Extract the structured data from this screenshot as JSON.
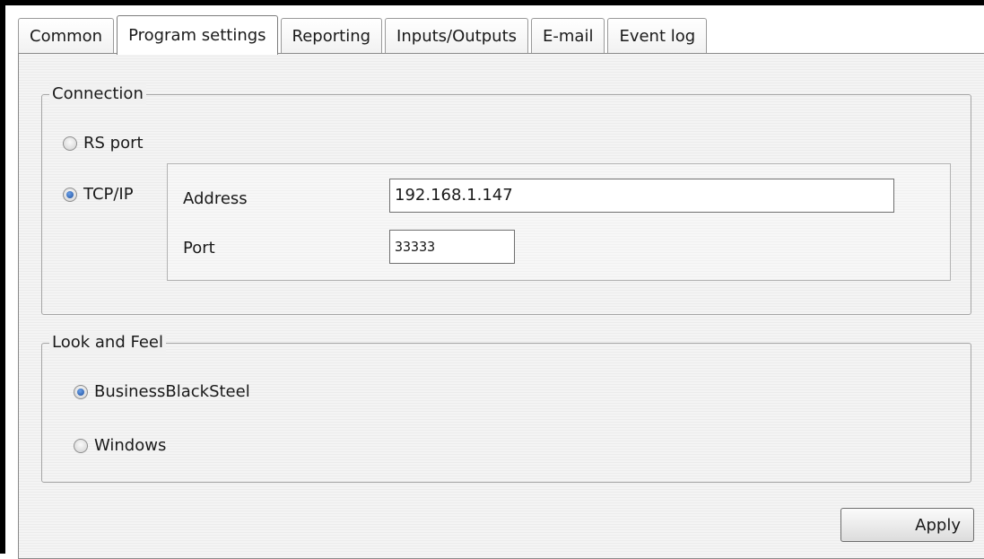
{
  "tabs": [
    {
      "label": "Common",
      "active": false
    },
    {
      "label": "Program settings",
      "active": true
    },
    {
      "label": "Reporting",
      "active": false
    },
    {
      "label": "Inputs/Outputs",
      "active": false
    },
    {
      "label": "E-mail",
      "active": false
    },
    {
      "label": "Event log",
      "active": false
    }
  ],
  "connection": {
    "legend": "Connection",
    "rs_port_label": "RS port",
    "rs_port_selected": false,
    "tcp_label": "TCP/IP",
    "tcp_selected": true,
    "address_label": "Address",
    "address_value": "192.168.1.147",
    "port_label": "Port",
    "port_value": "33333"
  },
  "look_and_feel": {
    "legend": "Look and Feel",
    "options": [
      {
        "label": "BusinessBlackSteel",
        "selected": true
      },
      {
        "label": "Windows",
        "selected": false
      }
    ]
  },
  "actions": {
    "apply_label": "Apply"
  },
  "icons": {
    "radio_checked": "radio-checked-icon",
    "radio_unchecked": "radio-unchecked-icon"
  }
}
